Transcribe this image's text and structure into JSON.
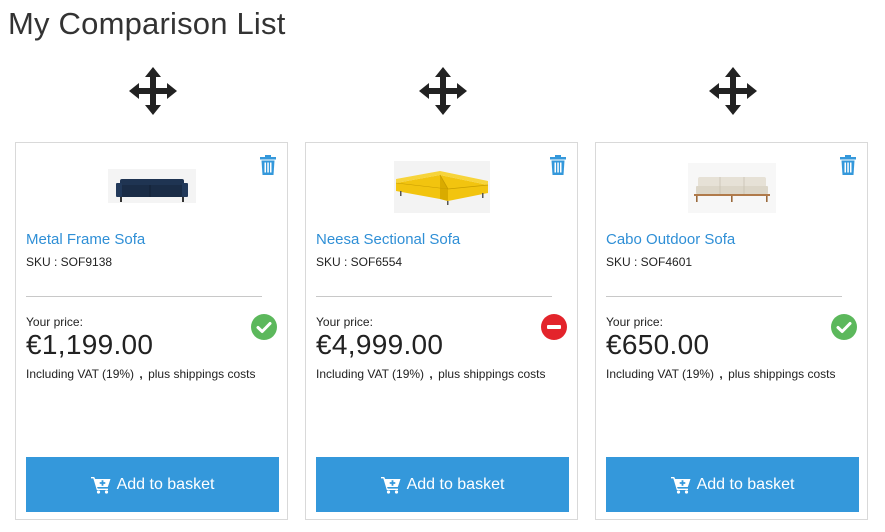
{
  "page": {
    "title": "My Comparison List"
  },
  "labels": {
    "your_price": "Your price:",
    "vat_text": "Including VAT (19%)",
    "vat_separator": ",",
    "shipping_text": "plus shippings costs",
    "add_to_basket": "Add to basket",
    "sku_prefix": "SKU : "
  },
  "colors": {
    "accent": "#3498db",
    "link": "#2f8fd6",
    "available": "#5cb85c",
    "unavailable": "#e3242b"
  },
  "icons": {
    "move": "move-arrows-icon",
    "remove": "trash-icon",
    "cart": "cart-plus-icon",
    "available": "check-circle-icon",
    "unavailable": "minus-circle-icon"
  },
  "products": [
    {
      "name": "Metal Frame Sofa",
      "sku": "SKU : SOF9138",
      "price": "€1,199.00",
      "availability": "available",
      "image_color": "#1f3452"
    },
    {
      "name": "Neesa Sectional Sofa",
      "sku": "SKU : SOF6554",
      "price": "€4,999.00",
      "availability": "unavailable",
      "image_color": "#f2c40f"
    },
    {
      "name": "Cabo Outdoor Sofa",
      "sku": "SKU : SOF4601",
      "price": "€650.00",
      "availability": "available",
      "image_color": "#e6e1d6"
    }
  ]
}
